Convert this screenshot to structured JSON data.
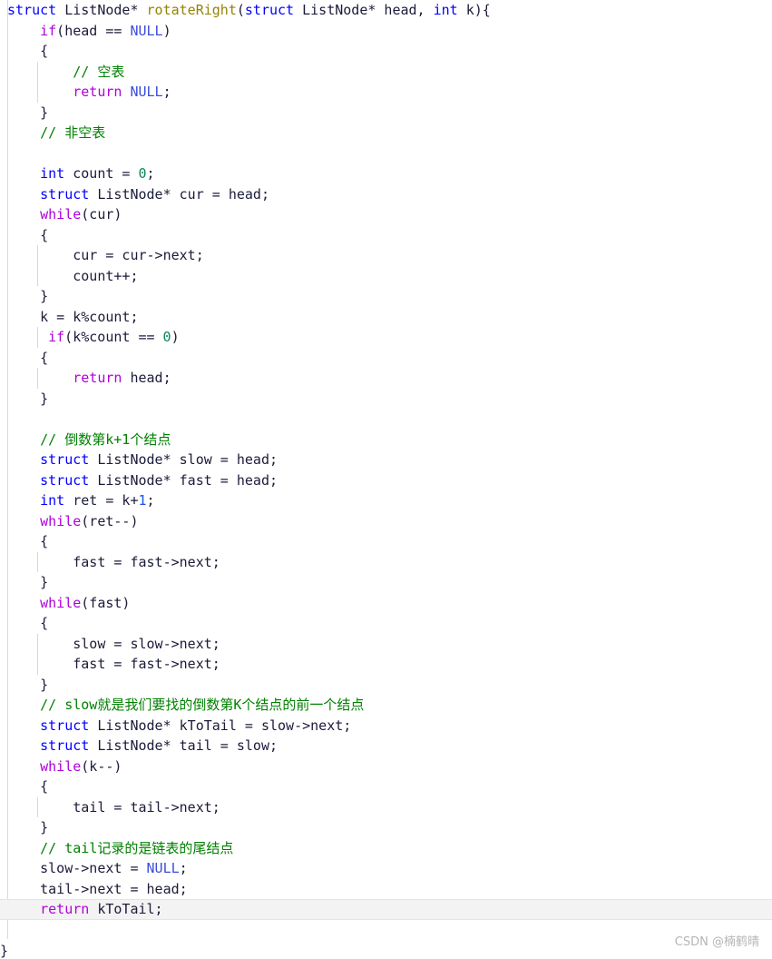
{
  "app": {
    "kind": "code-snippet-viewer",
    "language": "C",
    "background": "#ffffff",
    "watermark": "CSDN @楠鹤晴",
    "trailing_bracket": "}"
  },
  "theme": {
    "keyword": "#0000ff",
    "control": "#af00db",
    "function": "#948304",
    "comment": "#008000",
    "null_literal": "#3b4cdb",
    "number": "#098658",
    "plain": "#1b1b3a",
    "indent_guide": "#d8d8d8",
    "current_line_bg": "#f3f3f3",
    "current_line_border": "#e4e4e4"
  },
  "code": {
    "title": "rotateRight",
    "lines": [
      {
        "indent": 0,
        "guides": [],
        "current": false,
        "tokens": [
          {
            "t": "struct",
            "c": "kw"
          },
          {
            "t": " ",
            "c": "pl"
          },
          {
            "t": "ListNode*",
            "c": "pl"
          },
          {
            "t": " ",
            "c": "pl"
          },
          {
            "t": "rotateRight",
            "c": "fn"
          },
          {
            "t": "(",
            "c": "pl"
          },
          {
            "t": "struct",
            "c": "kw"
          },
          {
            "t": " ",
            "c": "pl"
          },
          {
            "t": "ListNode*",
            "c": "pl"
          },
          {
            "t": " head, ",
            "c": "pl"
          },
          {
            "t": "int",
            "c": "kw"
          },
          {
            "t": " k){",
            "c": "pl"
          }
        ]
      },
      {
        "indent": 1,
        "guides": [],
        "current": false,
        "tokens": [
          {
            "t": "if",
            "c": "ctl"
          },
          {
            "t": "(head == ",
            "c": "pl"
          },
          {
            "t": "NULL",
            "c": "nul"
          },
          {
            "t": ")",
            "c": "pl"
          }
        ]
      },
      {
        "indent": 1,
        "guides": [],
        "current": false,
        "tokens": [
          {
            "t": "{",
            "c": "pl"
          }
        ]
      },
      {
        "indent": 2,
        "guides": [
          "g1"
        ],
        "current": false,
        "tokens": [
          {
            "t": "// ",
            "c": "cmt"
          },
          {
            "t": "空表",
            "c": "cmt cn"
          }
        ]
      },
      {
        "indent": 2,
        "guides": [
          "g1"
        ],
        "current": false,
        "tokens": [
          {
            "t": "return",
            "c": "ctl"
          },
          {
            "t": " ",
            "c": "pl"
          },
          {
            "t": "NULL",
            "c": "nul"
          },
          {
            "t": ";",
            "c": "pl"
          }
        ]
      },
      {
        "indent": 1,
        "guides": [],
        "current": false,
        "tokens": [
          {
            "t": "}",
            "c": "pl"
          }
        ]
      },
      {
        "indent": 1,
        "guides": [],
        "current": false,
        "tokens": [
          {
            "t": "// ",
            "c": "cmt"
          },
          {
            "t": "非空表",
            "c": "cmt cn"
          }
        ]
      },
      {
        "indent": 1,
        "guides": [],
        "current": false,
        "tokens": [
          {
            "t": "",
            "c": "pl"
          }
        ]
      },
      {
        "indent": 1,
        "guides": [],
        "current": false,
        "tokens": [
          {
            "t": "int",
            "c": "kw"
          },
          {
            "t": " count = ",
            "c": "pl"
          },
          {
            "t": "0",
            "c": "num"
          },
          {
            "t": ";",
            "c": "pl"
          }
        ]
      },
      {
        "indent": 1,
        "guides": [],
        "current": false,
        "tokens": [
          {
            "t": "struct",
            "c": "kw"
          },
          {
            "t": " ",
            "c": "pl"
          },
          {
            "t": "ListNode*",
            "c": "pl"
          },
          {
            "t": " cur = head;",
            "c": "pl"
          }
        ]
      },
      {
        "indent": 1,
        "guides": [],
        "current": false,
        "tokens": [
          {
            "t": "while",
            "c": "ctl"
          },
          {
            "t": "(cur)",
            "c": "pl"
          }
        ]
      },
      {
        "indent": 1,
        "guides": [],
        "current": false,
        "tokens": [
          {
            "t": "{",
            "c": "pl"
          }
        ]
      },
      {
        "indent": 2,
        "guides": [
          "g1"
        ],
        "current": false,
        "tokens": [
          {
            "t": "cur = cur->next;",
            "c": "pl"
          }
        ]
      },
      {
        "indent": 2,
        "guides": [
          "g1"
        ],
        "current": false,
        "tokens": [
          {
            "t": "count++;",
            "c": "pl"
          }
        ]
      },
      {
        "indent": 1,
        "guides": [],
        "current": false,
        "tokens": [
          {
            "t": "}",
            "c": "pl"
          }
        ]
      },
      {
        "indent": 1,
        "guides": [],
        "current": false,
        "tokens": [
          {
            "t": "k = k%count;",
            "c": "pl"
          }
        ]
      },
      {
        "indent": 1,
        "guides": [
          "g1h"
        ],
        "current": false,
        "extra": 9,
        "tokens": [
          {
            "t": "if",
            "c": "ctl"
          },
          {
            "t": "(k%count == ",
            "c": "pl"
          },
          {
            "t": "0",
            "c": "num"
          },
          {
            "t": ")",
            "c": "pl"
          }
        ]
      },
      {
        "indent": 1,
        "guides": [],
        "current": false,
        "tokens": [
          {
            "t": "{",
            "c": "pl"
          }
        ]
      },
      {
        "indent": 2,
        "guides": [
          "g1"
        ],
        "current": false,
        "tokens": [
          {
            "t": "return",
            "c": "ctl"
          },
          {
            "t": " head;",
            "c": "pl"
          }
        ]
      },
      {
        "indent": 1,
        "guides": [],
        "current": false,
        "tokens": [
          {
            "t": "}",
            "c": "pl"
          }
        ]
      },
      {
        "indent": 1,
        "guides": [],
        "current": false,
        "tokens": [
          {
            "t": "",
            "c": "pl"
          }
        ]
      },
      {
        "indent": 1,
        "guides": [],
        "current": false,
        "tokens": [
          {
            "t": "// ",
            "c": "cmt"
          },
          {
            "t": "倒数第",
            "c": "cmt cn"
          },
          {
            "t": "k+1",
            "c": "cmt"
          },
          {
            "t": "个结点",
            "c": "cmt cn"
          }
        ]
      },
      {
        "indent": 1,
        "guides": [],
        "current": false,
        "tokens": [
          {
            "t": "struct",
            "c": "kw"
          },
          {
            "t": " ",
            "c": "pl"
          },
          {
            "t": "ListNode*",
            "c": "pl"
          },
          {
            "t": " slow = head;",
            "c": "pl"
          }
        ]
      },
      {
        "indent": 1,
        "guides": [],
        "current": false,
        "tokens": [
          {
            "t": "struct",
            "c": "kw"
          },
          {
            "t": " ",
            "c": "pl"
          },
          {
            "t": "ListNode*",
            "c": "pl"
          },
          {
            "t": " fast = head;",
            "c": "pl"
          }
        ]
      },
      {
        "indent": 1,
        "guides": [],
        "current": false,
        "tokens": [
          {
            "t": "int",
            "c": "kw"
          },
          {
            "t": " ret = k+",
            "c": "pl"
          },
          {
            "t": "1",
            "c": "numb"
          },
          {
            "t": ";",
            "c": "pl"
          }
        ]
      },
      {
        "indent": 1,
        "guides": [],
        "current": false,
        "tokens": [
          {
            "t": "while",
            "c": "ctl"
          },
          {
            "t": "(ret--)",
            "c": "pl"
          }
        ]
      },
      {
        "indent": 1,
        "guides": [],
        "current": false,
        "tokens": [
          {
            "t": "{",
            "c": "pl"
          }
        ]
      },
      {
        "indent": 2,
        "guides": [
          "g1"
        ],
        "current": false,
        "tokens": [
          {
            "t": "fast = fast->next;",
            "c": "pl"
          }
        ]
      },
      {
        "indent": 1,
        "guides": [],
        "current": false,
        "tokens": [
          {
            "t": "}",
            "c": "pl"
          }
        ]
      },
      {
        "indent": 1,
        "guides": [],
        "current": false,
        "tokens": [
          {
            "t": "while",
            "c": "ctl"
          },
          {
            "t": "(fast)",
            "c": "pl"
          }
        ]
      },
      {
        "indent": 1,
        "guides": [],
        "current": false,
        "tokens": [
          {
            "t": "{",
            "c": "pl"
          }
        ]
      },
      {
        "indent": 2,
        "guides": [
          "g1"
        ],
        "current": false,
        "tokens": [
          {
            "t": "slow = slow->next;",
            "c": "pl"
          }
        ]
      },
      {
        "indent": 2,
        "guides": [
          "g1"
        ],
        "current": false,
        "tokens": [
          {
            "t": "fast = fast->next;",
            "c": "pl"
          }
        ]
      },
      {
        "indent": 1,
        "guides": [],
        "current": false,
        "tokens": [
          {
            "t": "}",
            "c": "pl"
          }
        ]
      },
      {
        "indent": 1,
        "guides": [],
        "current": false,
        "tokens": [
          {
            "t": "// slow",
            "c": "cmt"
          },
          {
            "t": "就是我们要找的倒数第",
            "c": "cmt cn"
          },
          {
            "t": "K",
            "c": "cmt"
          },
          {
            "t": "个结点的前一个结点",
            "c": "cmt cn"
          }
        ]
      },
      {
        "indent": 1,
        "guides": [],
        "current": false,
        "tokens": [
          {
            "t": "struct",
            "c": "kw"
          },
          {
            "t": " ",
            "c": "pl"
          },
          {
            "t": "ListNode*",
            "c": "pl"
          },
          {
            "t": " kToTail = slow->next;",
            "c": "pl"
          }
        ]
      },
      {
        "indent": 1,
        "guides": [],
        "current": false,
        "tokens": [
          {
            "t": "struct",
            "c": "kw"
          },
          {
            "t": " ",
            "c": "pl"
          },
          {
            "t": "ListNode*",
            "c": "pl"
          },
          {
            "t": " tail = slow;",
            "c": "pl"
          }
        ]
      },
      {
        "indent": 1,
        "guides": [],
        "current": false,
        "tokens": [
          {
            "t": "while",
            "c": "ctl"
          },
          {
            "t": "(k--)",
            "c": "pl"
          }
        ]
      },
      {
        "indent": 1,
        "guides": [],
        "current": false,
        "tokens": [
          {
            "t": "{",
            "c": "pl"
          }
        ]
      },
      {
        "indent": 2,
        "guides": [
          "g1"
        ],
        "current": false,
        "tokens": [
          {
            "t": "tail = tail->next;",
            "c": "pl"
          }
        ]
      },
      {
        "indent": 1,
        "guides": [],
        "current": false,
        "tokens": [
          {
            "t": "}",
            "c": "pl"
          }
        ]
      },
      {
        "indent": 1,
        "guides": [],
        "current": false,
        "tokens": [
          {
            "t": "// tail",
            "c": "cmt"
          },
          {
            "t": "记录的是链表的尾结点",
            "c": "cmt cn"
          }
        ]
      },
      {
        "indent": 1,
        "guides": [],
        "current": false,
        "tokens": [
          {
            "t": "slow->next = ",
            "c": "pl"
          },
          {
            "t": "NULL",
            "c": "nul"
          },
          {
            "t": ";",
            "c": "pl"
          }
        ]
      },
      {
        "indent": 1,
        "guides": [],
        "current": false,
        "tokens": [
          {
            "t": "tail->next = head;",
            "c": "pl"
          }
        ]
      },
      {
        "indent": 1,
        "guides": [],
        "current": true,
        "tokens": [
          {
            "t": "return",
            "c": "ctl"
          },
          {
            "t": " kToTail;",
            "c": "pl"
          }
        ]
      }
    ]
  }
}
